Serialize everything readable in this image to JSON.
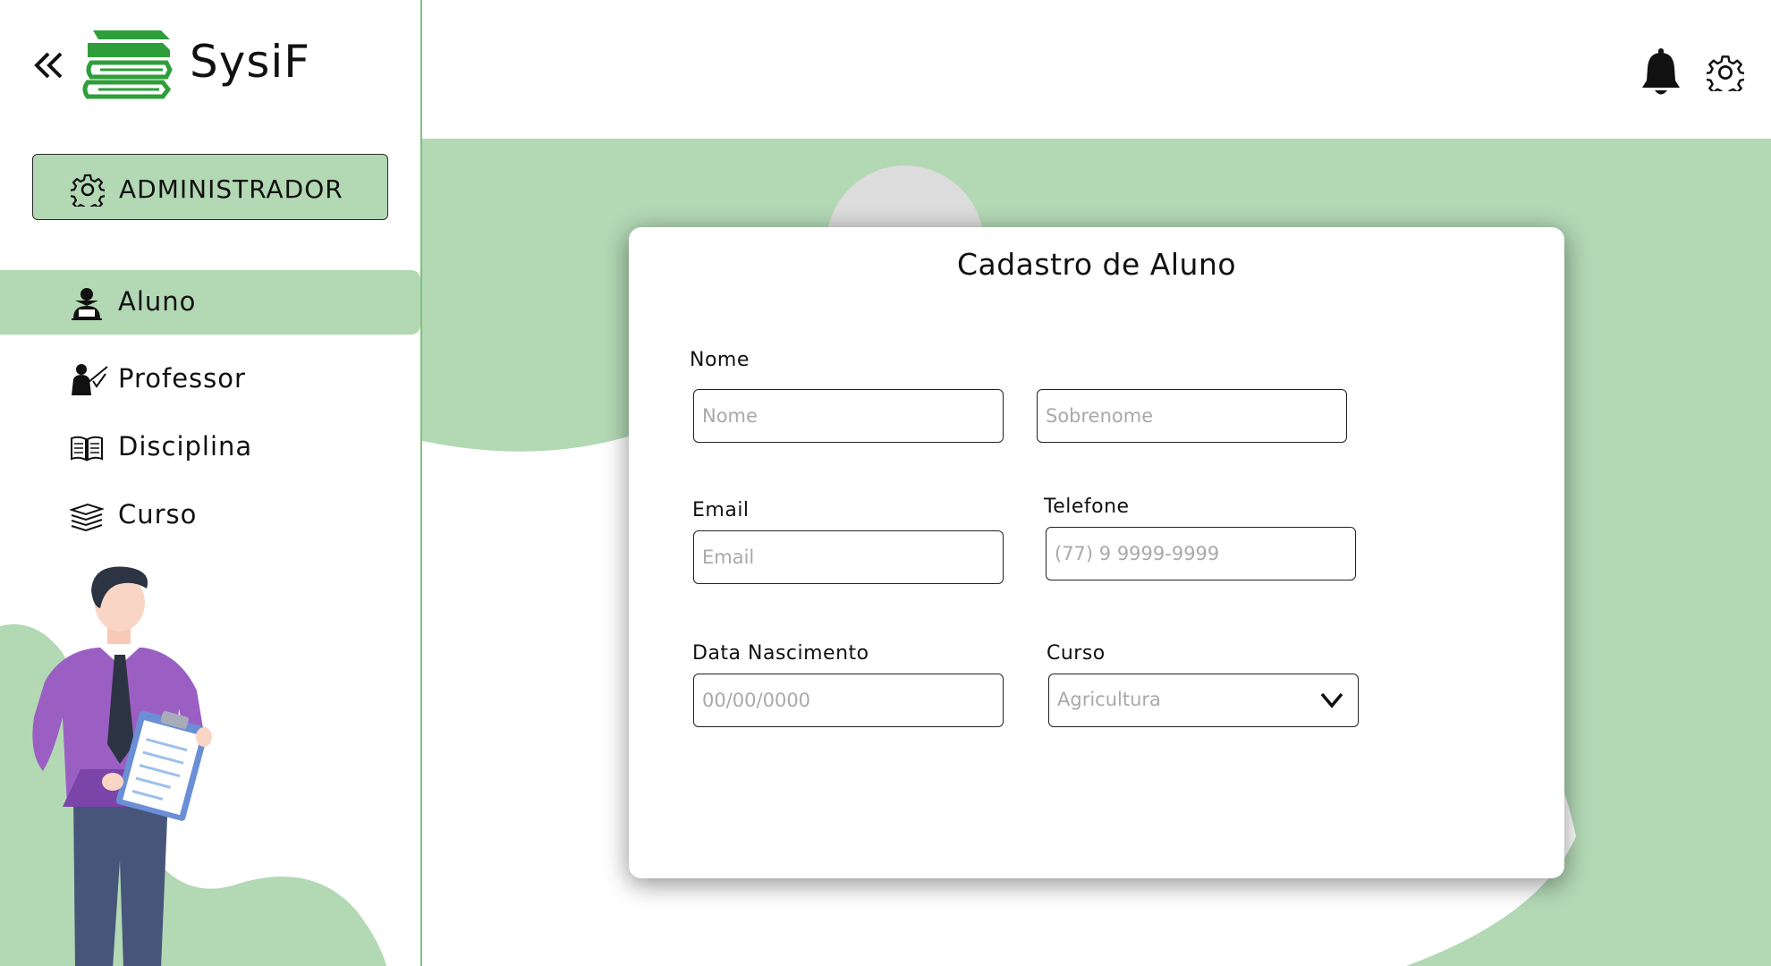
{
  "brand": {
    "name": "SysiF"
  },
  "sidebar": {
    "role_label": "ADMINISTRADOR",
    "items": [
      {
        "label": "Aluno",
        "icon": "student-icon",
        "active": true
      },
      {
        "label": "Professor",
        "icon": "teacher-icon",
        "active": false
      },
      {
        "label": "Disciplina",
        "icon": "book-icon",
        "active": false
      },
      {
        "label": "Curso",
        "icon": "books-stack-icon",
        "active": false
      }
    ]
  },
  "header": {
    "icons": [
      "bell-icon",
      "gear-icon"
    ]
  },
  "form": {
    "title": "Cadastro de Aluno",
    "nome_label": "Nome",
    "nome_placeholder": "Nome",
    "sobrenome_placeholder": "Sobrenome",
    "email_label": "Email",
    "email_placeholder": "Email",
    "telefone_label": "Telefone",
    "telefone_placeholder": "(77) 9 9999-9999",
    "nascimento_label": "Data Nascimento",
    "nascimento_placeholder": "00/00/0000",
    "curso_label": "Curso",
    "curso_value": "Agricultura"
  },
  "colors": {
    "accent": "#b3d8b4",
    "logo_green": "#2e9e3a",
    "border": "#7fc07f"
  }
}
